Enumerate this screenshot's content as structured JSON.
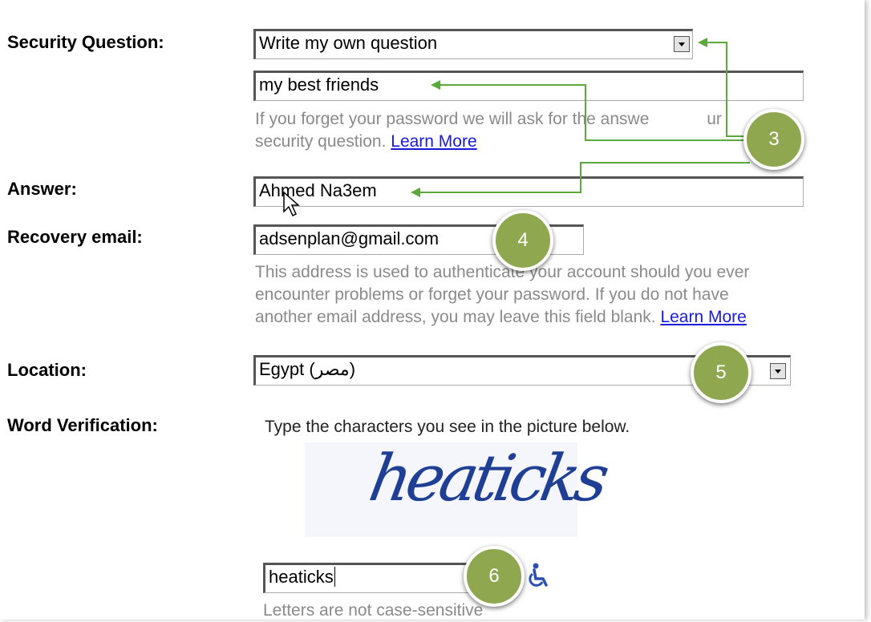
{
  "security_question": {
    "label": "Security Question:",
    "selected": "Write my own question",
    "own_question_value": "my best friends",
    "help_line1": "If you forget your password we will ask for the answe",
    "help_line1_tail": "ur",
    "help_line2": "security question.",
    "learn_more": "Learn More"
  },
  "answer": {
    "label": "Answer:",
    "value": "Ahmed Na3em"
  },
  "recovery_email": {
    "label": "Recovery email:",
    "value": "adsenplan@gmail.com",
    "help_line1": "This address is used to authenticate your account should you ever",
    "help_line2": "encounter problems or forget your password. If you do not have",
    "help_line3": "another email address, you may leave this field blank.",
    "learn_more": "Learn More"
  },
  "location": {
    "label": "Location:",
    "selected": "Egypt (مصر)"
  },
  "word_verification": {
    "label": "Word Verification:",
    "instruction": "Type the characters you see in the picture below.",
    "captcha_text": "heaticks",
    "input_value": "heaticks",
    "hint": "Letters are not case-sensitive",
    "accessibility_icon": "wheelchair-icon"
  },
  "badges": [
    "3",
    "4",
    "5",
    "6"
  ],
  "colors": {
    "badge": "#8fa84f",
    "arrow": "#5ca83a",
    "link": "#1a1ad8",
    "help_text": "#8a8a8a"
  }
}
